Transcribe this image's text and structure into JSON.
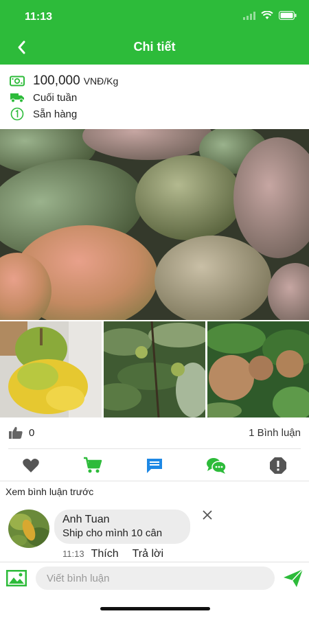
{
  "status_bar": {
    "time": "11:13"
  },
  "header": {
    "title": "Chi tiết",
    "back_icon": "chevron-left-icon"
  },
  "product": {
    "price": "100,000",
    "unit": "VNĐ/Kg",
    "delivery": "Cuối tuần",
    "stock": "Sẵn hàng"
  },
  "photos": {
    "main": "mangoes-photo",
    "thumbnails": [
      "bananas-photo",
      "fruit-tree-photo",
      "sapodilla-tree-photo"
    ]
  },
  "stats": {
    "likes": "0",
    "comments_label": "1 Bình luận"
  },
  "actions": [
    {
      "name": "heart-icon",
      "color": "#555555"
    },
    {
      "name": "cart-icon",
      "color": "#2dbb3a"
    },
    {
      "name": "message-icon",
      "color": "#1e88e5"
    },
    {
      "name": "chat-icon",
      "color": "#2dbb3a"
    },
    {
      "name": "report-icon",
      "color": "#555555"
    }
  ],
  "comments_section": {
    "view_previous": "Xem bình luận trước",
    "items": [
      {
        "author": "Anh Tuan",
        "text": "Ship cho mình 10 cân",
        "time": "11:13",
        "like_label": "Thích",
        "reply_label": "Trả lời"
      }
    ]
  },
  "comment_input": {
    "placeholder": "Viết bình luận"
  },
  "colors": {
    "brand": "#2dbb3a",
    "accent_blue": "#1e88e5"
  }
}
